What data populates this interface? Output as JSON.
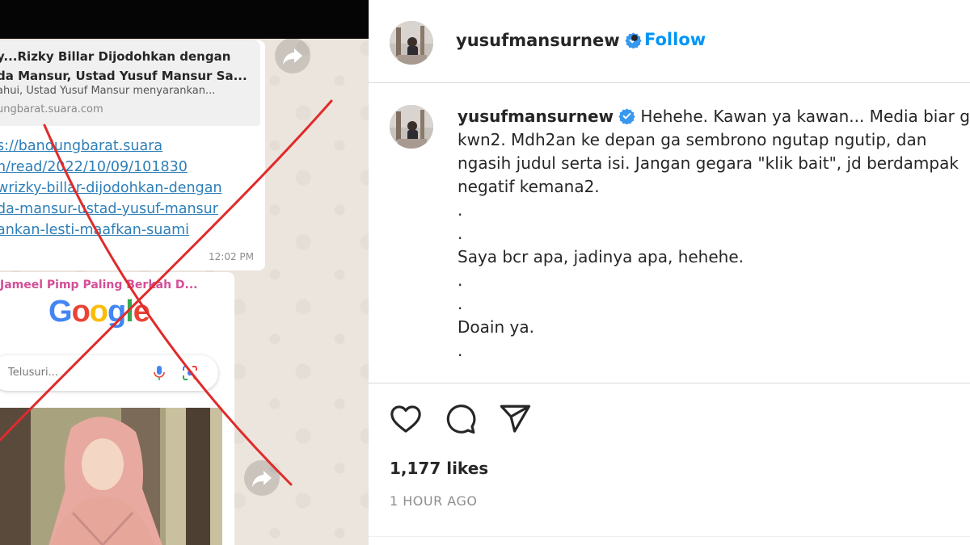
{
  "whatsapp": {
    "link_preview": {
      "title": "y...Rizky Billar Dijodohkan dengan\nda Mansur, Ustad Yusuf Mansur Sa...",
      "description": "ahui, Ustad Yusuf Mansur menyarankan...",
      "domain": "ungbarat.suara.com"
    },
    "link_url": "s://bandungbarat.suara\nn/read/2022/10/09/101830\nwrizky-billar-dijodohkan-dengan\nda-mansur-ustad-yusuf-mansur\nankan-lesti-maafkan-suami",
    "link_time": "12:02 PM",
    "image_caption": "Jameel Pimp Paling Berkah D...",
    "google_logo": {
      "letters": [
        "G",
        "o",
        "o",
        "g",
        "l",
        "e"
      ],
      "colors": [
        "#4285f4",
        "#ea4335",
        "#fbbc05",
        "#4285f4",
        "#34a853",
        "#ea4335"
      ]
    },
    "search_placeholder": "Telusuri...",
    "icons": [
      "forward-icon",
      "mic-icon",
      "lens-icon"
    ],
    "overlay": "red-cross",
    "overlay_color": "#e02b2b"
  },
  "instagram": {
    "header": {
      "username": "yusufmansurnew",
      "separator": "•",
      "follow_label": "Follow"
    },
    "caption": {
      "username": "yusufmansurnew",
      "lines": [
        "Hehehe. Kawan ya kawan... Media biar gm",
        "kwn2. Mdh2an ke depan ga sembrono ngutap ngutip, dan",
        "ngasih judul serta isi. Jangan gegara \"klik bait\", jd berdampak",
        "negatif kemana2.",
        ".",
        ".",
        "Saya bcr apa, jadinya apa, hehehe.",
        ".",
        ".",
        "Doain ya.",
        "."
      ]
    },
    "likes": "1,177 likes",
    "time_ago": "1 HOUR AGO",
    "colors": {
      "follow": "#0095f6",
      "verified": "#3897f0",
      "text": "#262626",
      "muted": "#8e8e8e"
    },
    "icons": [
      "verified-badge-icon",
      "heart-icon",
      "comment-icon",
      "share-icon"
    ]
  }
}
